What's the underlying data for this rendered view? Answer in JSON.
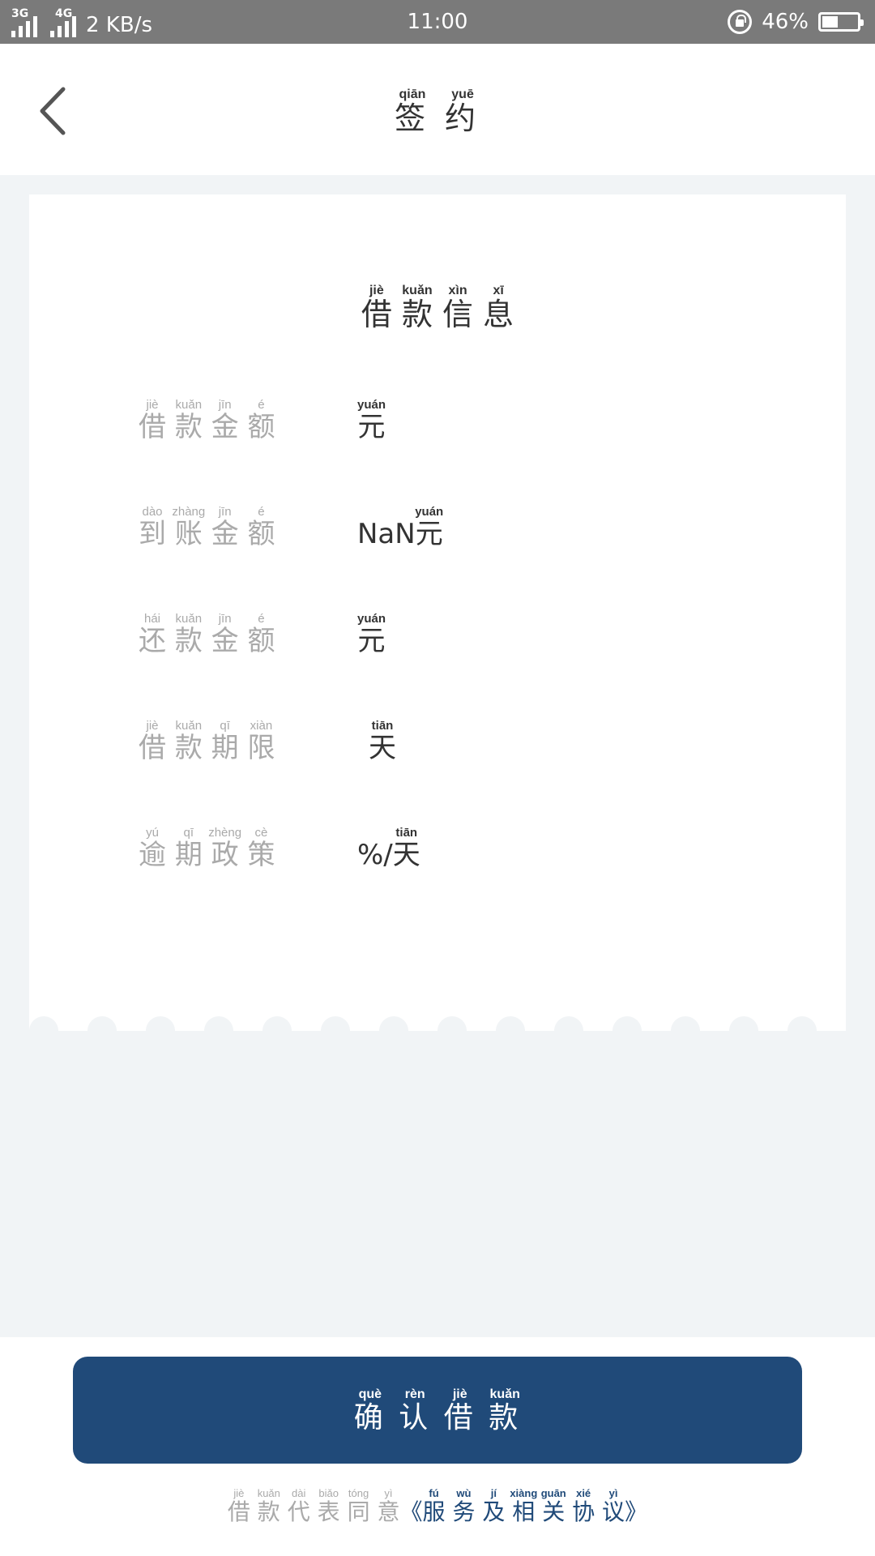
{
  "status_bar": {
    "net1": "3G",
    "net2": "4G",
    "net2_prefix": "4G",
    "speed": "2 KB/s",
    "time": "11:00",
    "battery": "46%",
    "battery_level": 0.46,
    "icons": [
      "signal-icon",
      "lock-rotation-icon",
      "battery-icon"
    ]
  },
  "header": {
    "back_icon": "chevron-left-icon",
    "title": [
      {
        "char": "签",
        "pinyin": "qiān"
      },
      {
        "char": "约",
        "pinyin": "yuē"
      }
    ]
  },
  "card": {
    "title": [
      {
        "char": "借",
        "pinyin": "jiè"
      },
      {
        "char": "款",
        "pinyin": "kuǎn"
      },
      {
        "char": "信",
        "pinyin": "xìn"
      },
      {
        "char": "息",
        "pinyin": "xī"
      }
    ],
    "rows": [
      {
        "label": [
          {
            "char": "借",
            "pinyin": "jiè"
          },
          {
            "char": "款",
            "pinyin": "kuǎn"
          },
          {
            "char": "金",
            "pinyin": "jīn"
          },
          {
            "char": "额",
            "pinyin": "é"
          }
        ],
        "value_prefix": "",
        "value_unit": {
          "char": "元",
          "pinyin": "yuán"
        }
      },
      {
        "label": [
          {
            "char": "到",
            "pinyin": "dào"
          },
          {
            "char": "账",
            "pinyin": "zhàng"
          },
          {
            "char": "金",
            "pinyin": "jīn"
          },
          {
            "char": "额",
            "pinyin": "é"
          }
        ],
        "value_prefix": "NaN",
        "value_unit": {
          "char": "元",
          "pinyin": "yuán"
        }
      },
      {
        "label": [
          {
            "char": "还",
            "pinyin": "hái"
          },
          {
            "char": "款",
            "pinyin": "kuǎn"
          },
          {
            "char": "金",
            "pinyin": "jīn"
          },
          {
            "char": "额",
            "pinyin": "é"
          }
        ],
        "value_prefix": "",
        "value_unit": {
          "char": "元",
          "pinyin": "yuán"
        }
      },
      {
        "label": [
          {
            "char": "借",
            "pinyin": "jiè"
          },
          {
            "char": "款",
            "pinyin": "kuǎn"
          },
          {
            "char": "期",
            "pinyin": "qī"
          },
          {
            "char": "限",
            "pinyin": "xiàn"
          }
        ],
        "value_prefix": "",
        "value_unit": {
          "char": "天",
          "pinyin": "tiān"
        }
      },
      {
        "label": [
          {
            "char": "逾",
            "pinyin": "yú"
          },
          {
            "char": "期",
            "pinyin": "qī"
          },
          {
            "char": "政",
            "pinyin": "zhèng"
          },
          {
            "char": "策",
            "pinyin": "cè"
          }
        ],
        "value_prefix": "%/",
        "value_unit": {
          "char": "天",
          "pinyin": "tiān"
        }
      }
    ]
  },
  "confirm_button": [
    {
      "char": "确",
      "pinyin": "què"
    },
    {
      "char": "认",
      "pinyin": "rèn"
    },
    {
      "char": "借",
      "pinyin": "jiè"
    },
    {
      "char": "款",
      "pinyin": "kuǎn"
    }
  ],
  "agreement": {
    "prefix": [
      {
        "char": "借",
        "pinyin": "jiè"
      },
      {
        "char": "款",
        "pinyin": "kuǎn"
      },
      {
        "char": "代",
        "pinyin": "dài"
      },
      {
        "char": "表",
        "pinyin": "biǎo"
      },
      {
        "char": "同",
        "pinyin": "tóng"
      },
      {
        "char": "意",
        "pinyin": "yì"
      }
    ],
    "open_quote": "《",
    "link": [
      {
        "char": "服",
        "pinyin": "fú"
      },
      {
        "char": "务",
        "pinyin": "wù"
      },
      {
        "char": "及",
        "pinyin": "jí"
      },
      {
        "char": "相",
        "pinyin": "xiàng"
      },
      {
        "char": "关",
        "pinyin": "guān"
      },
      {
        "char": "协",
        "pinyin": "xié"
      },
      {
        "char": "议",
        "pinyin": "yì"
      }
    ],
    "close_quote": "》"
  },
  "colors": {
    "primary": "#204a79",
    "background": "#f1f4f6",
    "label_gray": "#aaaaaa",
    "status_bar": "#7a7a7a"
  }
}
